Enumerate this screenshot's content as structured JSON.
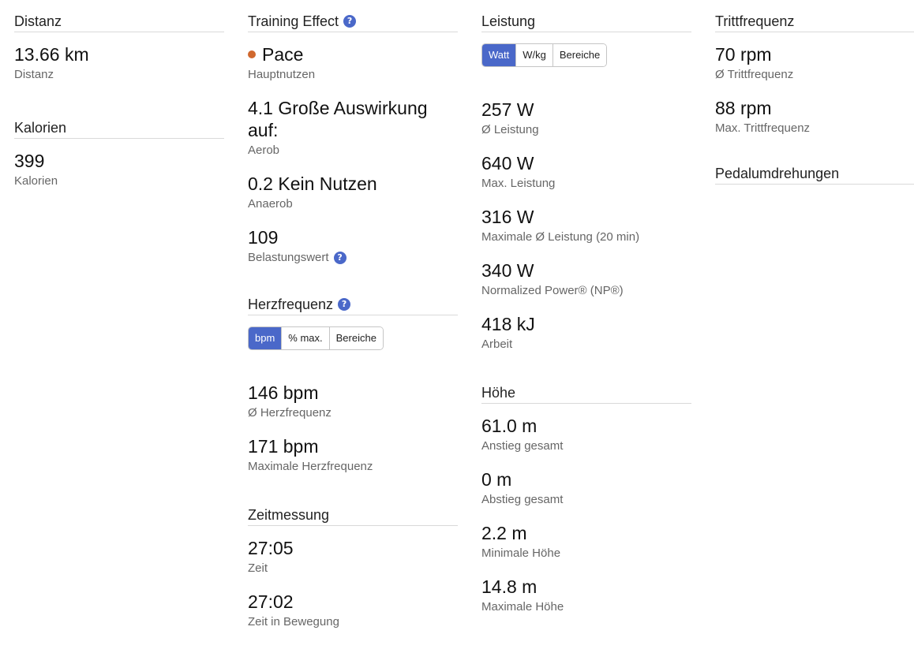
{
  "distance": {
    "title": "Distanz",
    "value": "13.66 km",
    "label": "Distanz"
  },
  "calories": {
    "title": "Kalorien",
    "value": "399",
    "label": "Kalorien"
  },
  "training_effect": {
    "title": "Training Effect",
    "primary_value": "Pace",
    "primary_label": "Hauptnutzen",
    "aerobic_value": "4.1 Große Auswirkung auf:",
    "aerobic_label": "Aerob",
    "anaerobic_value": "0.2 Kein Nutzen",
    "anaerobic_label": "Anaerob",
    "load_value": "109",
    "load_label": "Belastungswert",
    "dot_color": "#d0682e"
  },
  "heart_rate": {
    "title": "Herzfrequenz",
    "toggle": [
      "bpm",
      "% max.",
      "Bereiche"
    ],
    "avg_value": "146 bpm",
    "avg_label": "Ø Herzfrequenz",
    "max_value": "171 bpm",
    "max_label": "Maximale Herzfrequenz"
  },
  "timing": {
    "title": "Zeitmessung",
    "time_value": "27:05",
    "time_label": "Zeit",
    "moving_value": "27:02",
    "moving_label": "Zeit in Bewegung"
  },
  "power": {
    "title": "Leistung",
    "toggle": [
      "Watt",
      "W/kg",
      "Bereiche"
    ],
    "avg_value": "257 W",
    "avg_label": "Ø Leistung",
    "max_value": "640 W",
    "max_label": "Max. Leistung",
    "max20_value": "316 W",
    "max20_label": "Maximale Ø Leistung (20 min)",
    "np_value": "340 W",
    "np_label": "Normalized Power® (NP®)",
    "work_value": "418 kJ",
    "work_label": "Arbeit"
  },
  "elevation": {
    "title": "Höhe",
    "gain_value": "61.0 m",
    "gain_label": "Anstieg gesamt",
    "loss_value": "0 m",
    "loss_label": "Abstieg gesamt",
    "min_value": "2.2 m",
    "min_label": "Minimale Höhe",
    "max_value": "14.8 m",
    "max_label": "Maximale Höhe"
  },
  "cadence": {
    "title": "Trittfrequenz",
    "avg_value": "70 rpm",
    "avg_label": "Ø Trittfrequenz",
    "max_value": "88 rpm",
    "max_label": "Max. Trittfrequenz"
  },
  "pedal": {
    "title": "Pedalumdrehungen"
  },
  "help_glyph": "?",
  "accent_color": "#4a68c9"
}
